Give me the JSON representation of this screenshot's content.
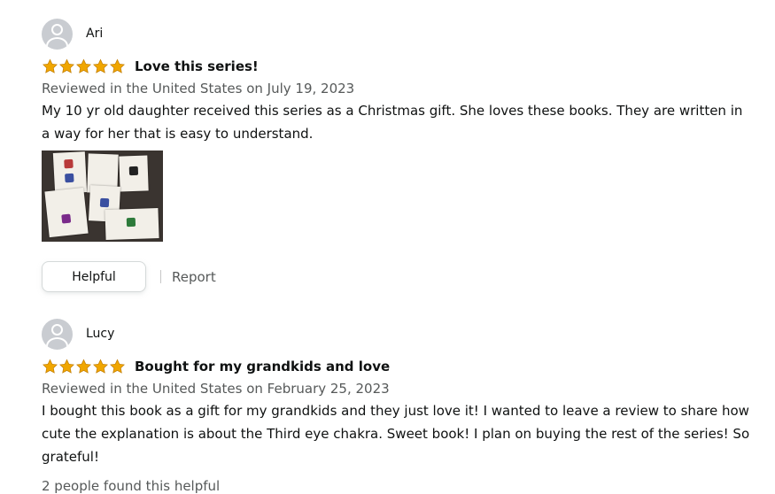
{
  "reviews": [
    {
      "reviewer": "Ari",
      "rating": 5,
      "title": "Love this series!",
      "date": "Reviewed in the United States on July 19, 2023",
      "body": "My 10 yr old daughter received this series as a Christmas gift. She loves these books. They are written in a way for her that is easy to understand.",
      "has_photo": true,
      "helpful_label": "Helpful",
      "report_label": "Report"
    },
    {
      "reviewer": "Lucy",
      "rating": 5,
      "title": "Bought for my grandkids and love",
      "date": "Reviewed in the United States on February 25, 2023",
      "body": "I bought this book as a gift for my grandkids and they just love it! I wanted to leave a review to share how cute the explanation is about the Third eye chakra. Sweet book! I plan on buying the rest of the series! So grateful!",
      "helpful_count": "2 people found this helpful"
    }
  ],
  "colors": {
    "star": "#f0a600",
    "star_outline": "#c07b00",
    "secondary_text": "#565959",
    "button_border": "#d5d9d9"
  },
  "icons": {
    "avatar": "default-profile-icon",
    "star": "star-icon"
  }
}
